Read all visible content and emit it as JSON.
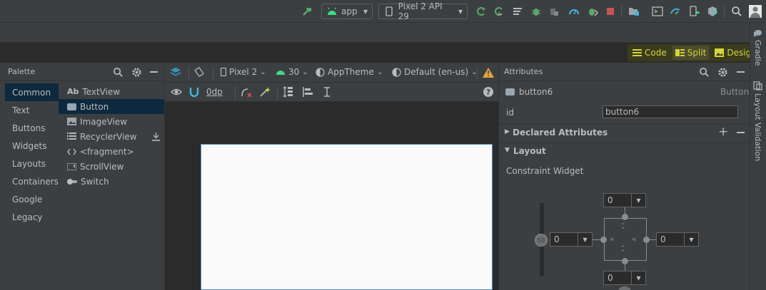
{
  "top_toolbar": {
    "app_label": "app",
    "device_label": "Pixel 2 API 29"
  },
  "mode_bar": {
    "code_label": "Code",
    "split_label": "Split",
    "design_label": "Design"
  },
  "side_tabs": {
    "gradle": "Gradle",
    "layout_validation": "Layout Validation"
  },
  "palette": {
    "title": "Palette",
    "categories": [
      "Common",
      "Text",
      "Buttons",
      "Widgets",
      "Layouts",
      "Containers",
      "Google",
      "Legacy"
    ],
    "items": [
      {
        "label": "TextView",
        "icon": "textview-icon",
        "prefix": "Ab"
      },
      {
        "label": "Button",
        "icon": "button-icon"
      },
      {
        "label": "ImageView",
        "icon": "image-icon"
      },
      {
        "label": "RecyclerView",
        "icon": "list-icon"
      },
      {
        "label": "<fragment>",
        "icon": "code-icon"
      },
      {
        "label": "ScrollView",
        "icon": "scrollview-icon"
      },
      {
        "label": "Switch",
        "icon": "switch-icon"
      }
    ]
  },
  "design_toolbar": {
    "device": "Pixel 2",
    "api": "30",
    "theme": "AppTheme",
    "locale": "Default (en-us)",
    "dp_value": "0dp"
  },
  "attributes": {
    "title": "Attributes",
    "component_name": "button6",
    "component_type": "Button",
    "id_label": "id",
    "id_value": "button6",
    "declared_section": "Declared Attributes",
    "layout_section": "Layout",
    "constraint_title": "Constraint Widget",
    "margin_top": "0",
    "margin_left": "0",
    "margin_right": "0",
    "margin_bottom": "0",
    "bias_value": "50"
  },
  "colors": {
    "accent_yellow": "#d4d43c",
    "android_green": "#3ddc84",
    "selection_blue": "#0d293e"
  }
}
